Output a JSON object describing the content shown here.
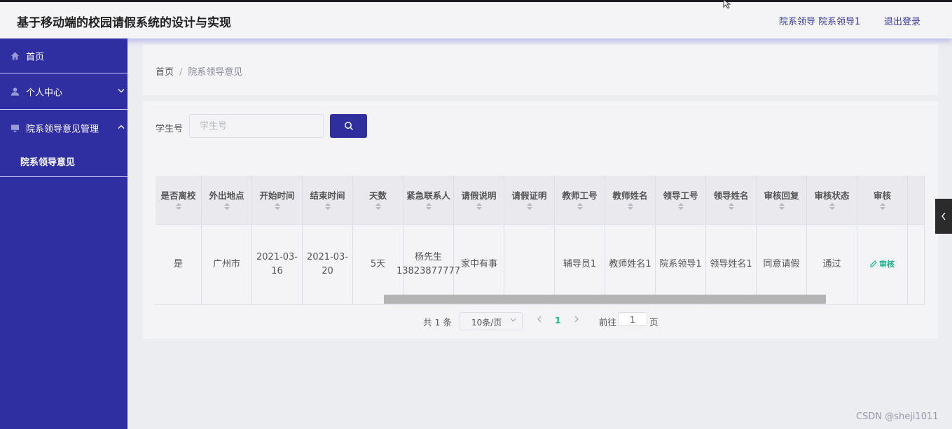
{
  "header": {
    "title": "基于移动端的校园请假系统的设计与实现",
    "user": "院系领导 院系领导1",
    "logout": "退出登录"
  },
  "sidebar": {
    "items": [
      {
        "label": "首页",
        "icon": "home-icon"
      },
      {
        "label": "个人中心",
        "icon": "user-icon",
        "chevron": "⌄"
      },
      {
        "label": "院系领导意见管理",
        "icon": "monitor-icon",
        "chevron": "⌃"
      }
    ],
    "subitem": "院系领导意见"
  },
  "breadcrumb": {
    "home": "首页",
    "separator": "/",
    "current": "院系领导意见"
  },
  "search": {
    "label": "学生号",
    "placeholder": "学生号"
  },
  "table": {
    "columns": [
      {
        "label": "是否离校",
        "sortable": true
      },
      {
        "label": "外出地点",
        "sortable": true
      },
      {
        "label": "开始时间",
        "sortable": true
      },
      {
        "label": "结束时间",
        "sortable": true
      },
      {
        "label": "天数",
        "sortable": true
      },
      {
        "label": "紧急联系人",
        "sortable": true
      },
      {
        "label": "请假说明",
        "sortable": true
      },
      {
        "label": "请假证明",
        "sortable": true
      },
      {
        "label": "教师工号",
        "sortable": true
      },
      {
        "label": "教师姓名",
        "sortable": true
      },
      {
        "label": "领导工号",
        "sortable": true
      },
      {
        "label": "领导姓名",
        "sortable": true
      },
      {
        "label": "审核回复",
        "sortable": true
      },
      {
        "label": "审核状态",
        "sortable": true
      },
      {
        "label": "审核",
        "sortable": true
      }
    ],
    "rows": [
      [
        "是",
        "广州市",
        "2021-03-16",
        "2021-03-20",
        "5天",
        "杨先生 13823877777",
        "家中有事",
        "",
        "辅导员1",
        "教师姓名1",
        "院系领导1",
        "领导姓名1",
        "同意请假",
        "通过",
        "审核"
      ]
    ]
  },
  "pagination": {
    "total": "共 1 条",
    "page_size": "10条/页",
    "current_page": "1",
    "goto_label": "前往",
    "goto_value": "1",
    "page_unit": "页"
  },
  "watermark": "CSDN @sheji1011",
  "colors": {
    "sidebar": "#2f2fa2",
    "primary_button": "#2e2e9c",
    "accent_link": "#19b28c"
  }
}
